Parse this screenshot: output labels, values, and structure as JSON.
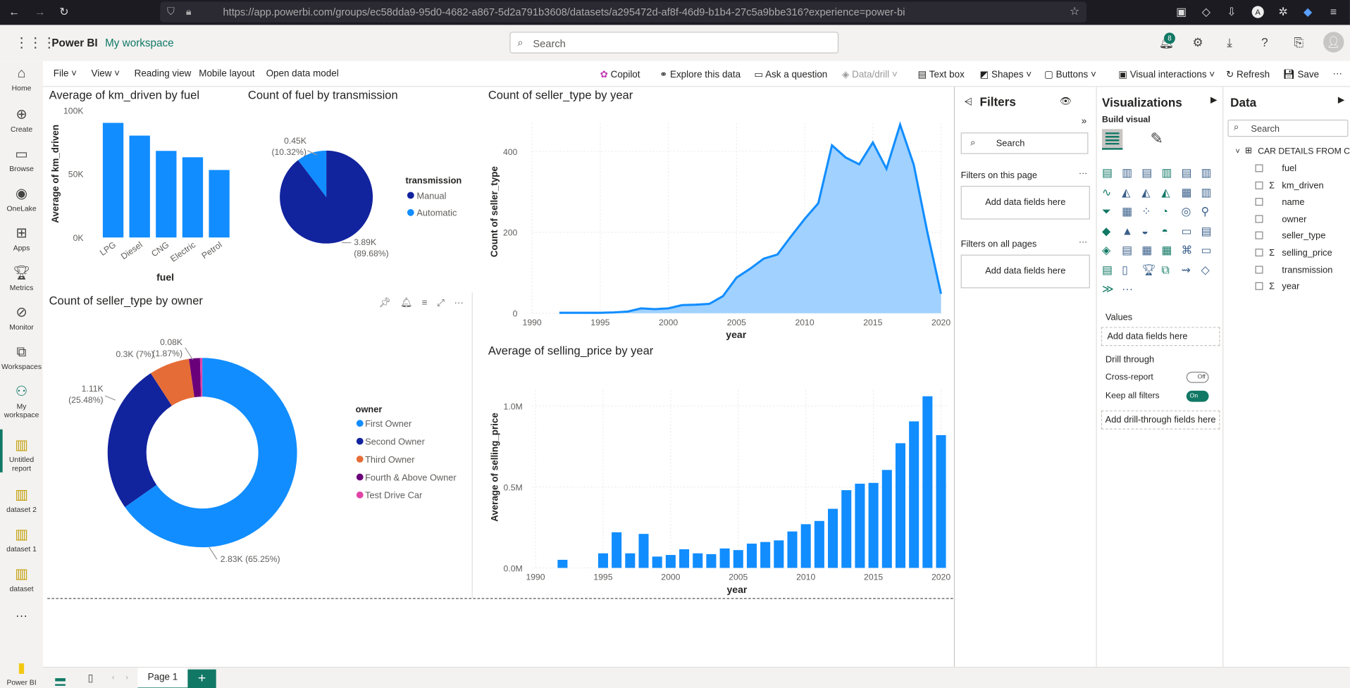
{
  "browser": {
    "url": "https://app.powerbi.com/groups/ec58dda9-95d0-4682-a867-5d2a791b3608/datasets/a295472d-af8f-46d9-b1b4-27c5a9bbe316?experience=power-bi"
  },
  "header": {
    "app": "Power BI",
    "workspace": "My workspace",
    "search_placeholder": "Search",
    "notif_count": "8"
  },
  "nav": [
    "Home",
    "Create",
    "Browse",
    "OneLake",
    "Apps",
    "Metrics",
    "Monitor",
    "Workspaces",
    "My workspace",
    "Untitled report",
    "dataset 2",
    "dataset 1",
    "dataset",
    "Power BI"
  ],
  "ribbon": {
    "left": [
      "File",
      "View",
      "Reading view",
      "Mobile layout",
      "Open data model"
    ],
    "right": [
      "Copilot",
      "Explore this data",
      "Ask a question",
      "Data/drill",
      "Text box",
      "Shapes",
      "Buttons",
      "Visual interactions",
      "Refresh",
      "Save"
    ]
  },
  "visuals": {
    "v1_title": "Average of km_driven by fuel",
    "v2_title": "Count of fuel by transmission",
    "v3_title": "Count of seller_type by year",
    "v4_title": "Count of seller_type by owner",
    "v5_title": "Average of selling_price by year"
  },
  "chart_data": [
    {
      "type": "bar",
      "title": "Average of km_driven by fuel",
      "categories": [
        "LPG",
        "Diesel",
        "CNG",
        "Electric",
        "Petrol"
      ],
      "values": [
        90000,
        80000,
        68000,
        63000,
        53000
      ],
      "xlabel": "fuel",
      "ylabel": "Average of km_driven",
      "ylim": [
        0,
        100000
      ],
      "yticks": [
        "0K",
        "50K",
        "100K"
      ]
    },
    {
      "type": "pie",
      "title": "Count of fuel by transmission",
      "legend_title": "transmission",
      "slices": [
        {
          "name": "Manual",
          "value": 3890,
          "label": "3.89K",
          "pct": "(89.68%)",
          "color": "#12239e"
        },
        {
          "name": "Automatic",
          "value": 450,
          "label": "0.45K",
          "pct": "(10.32%)",
          "color": "#118dff"
        }
      ]
    },
    {
      "type": "area",
      "title": "Count of seller_type by year",
      "xlabel": "year",
      "ylabel": "Count of seller_type",
      "xlim": [
        1990,
        2020
      ],
      "ylim": [
        0,
        470
      ],
      "xticks": [
        "1990",
        "1995",
        "2000",
        "2005",
        "2010",
        "2015",
        "2020"
      ],
      "yticks": [
        "0",
        "200",
        "400"
      ],
      "x": [
        1992,
        1993,
        1994,
        1995,
        1996,
        1997,
        1998,
        1999,
        2000,
        2001,
        2002,
        2003,
        2004,
        2005,
        2006,
        2007,
        2008,
        2009,
        2010,
        2011,
        2012,
        2013,
        2014,
        2015,
        2016,
        2017,
        2018,
        2019,
        2020
      ],
      "y": [
        1,
        1,
        1,
        1,
        2,
        4,
        12,
        10,
        12,
        20,
        21,
        23,
        42,
        88,
        110,
        135,
        145,
        190,
        233,
        272,
        415,
        385,
        368,
        422,
        357,
        466,
        367,
        200,
        48
      ]
    },
    {
      "type": "pie",
      "title": "Count of seller_type by owner",
      "legend_title": "owner",
      "slices": [
        {
          "name": "First Owner",
          "value": 2830,
          "label": "2.83K (65.25%)",
          "color": "#118dff"
        },
        {
          "name": "Second Owner",
          "value": 1110,
          "label": "1.11K",
          "pct": "(25.48%)",
          "color": "#12239e"
        },
        {
          "name": "Third Owner",
          "value": 300,
          "label": "0.3K (7%)",
          "color": "#e66c37"
        },
        {
          "name": "Fourth & Above Owner",
          "value": 81,
          "label": "0.08K",
          "pct": "(1.87%)",
          "color": "#6b007b"
        },
        {
          "name": "Test Drive Car",
          "value": 17,
          "label": "",
          "color": "#e044a7"
        }
      ]
    },
    {
      "type": "bar",
      "title": "Average of selling_price by year",
      "xlabel": "year",
      "ylabel": "Average of selling_price",
      "xlim": [
        1990,
        2020
      ],
      "ylim": [
        0,
        1100000
      ],
      "xticks": [
        "1990",
        "1995",
        "2000",
        "2005",
        "2010",
        "2015",
        "2020"
      ],
      "yticks": [
        "0.0M",
        "0.5M",
        "1.0M"
      ],
      "x": [
        1992,
        1995,
        1996,
        1997,
        1998,
        1999,
        2000,
        2001,
        2002,
        2003,
        2004,
        2005,
        2006,
        2007,
        2008,
        2009,
        2010,
        2011,
        2012,
        2013,
        2014,
        2015,
        2016,
        2017,
        2018,
        2019,
        2020
      ],
      "y": [
        50000,
        90000,
        220000,
        90000,
        210000,
        70000,
        80000,
        115000,
        90000,
        85000,
        120000,
        110000,
        150000,
        160000,
        170000,
        225000,
        270000,
        290000,
        365000,
        480000,
        520000,
        525000,
        605000,
        770000,
        905000,
        1060000,
        820000
      ]
    }
  ],
  "filters": {
    "title": "Filters",
    "search": "Search",
    "on_page": "Filters on this page",
    "add1": "Add data fields here",
    "all_pages": "Filters on all pages",
    "add2": "Add data fields here"
  },
  "viz": {
    "title": "Visualizations",
    "build": "Build visual",
    "values": "Values",
    "add_values": "Add data fields here",
    "drill": "Drill through",
    "cross": "Cross-report",
    "cross_state": "Off",
    "keep": "Keep all filters",
    "keep_state": "On",
    "add_drill": "Add drill-through fields here"
  },
  "data": {
    "title": "Data",
    "search": "Search",
    "table": "CAR DETAILS FROM C...",
    "fields": [
      {
        "name": "fuel",
        "sum": false
      },
      {
        "name": "km_driven",
        "sum": true
      },
      {
        "name": "name",
        "sum": false
      },
      {
        "name": "owner",
        "sum": false
      },
      {
        "name": "seller_type",
        "sum": false
      },
      {
        "name": "selling_price",
        "sum": true
      },
      {
        "name": "transmission",
        "sum": false
      },
      {
        "name": "year",
        "sum": true
      }
    ]
  },
  "pages": {
    "page1": "Page 1"
  }
}
